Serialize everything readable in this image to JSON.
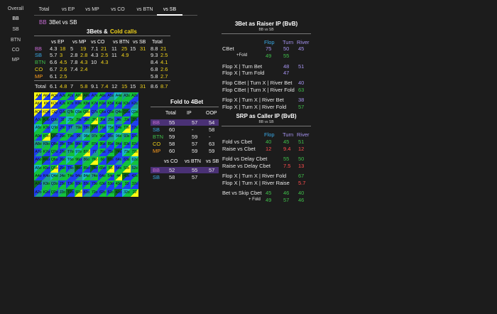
{
  "sidebar": {
    "items": [
      "Overall",
      "BB",
      "SB",
      "BTN",
      "CO",
      "MP"
    ],
    "active": "BB"
  },
  "tabs": {
    "items": [
      "Total",
      "vs EP",
      "vs MP",
      "vs CO",
      "vs BTN",
      "vs SB"
    ],
    "active": "vs SB"
  },
  "matchup": {
    "hero": "BB",
    "title": "3Bet vs SB"
  },
  "threebet_table": {
    "title_a": "3Bets &",
    "title_b": "Cold calls",
    "columns": [
      "vs EP",
      "vs MP",
      "vs CO",
      "vs BTN",
      "vs SB",
      "Total"
    ],
    "rows": [
      {
        "pos": "BB",
        "cells": [
          [
            "4.3",
            "18"
          ],
          [
            "5",
            "19"
          ],
          [
            "7.1",
            "21"
          ],
          [
            "11",
            "25"
          ],
          [
            "15",
            "31"
          ],
          [
            "8.8",
            "21"
          ]
        ]
      },
      {
        "pos": "SB",
        "cells": [
          [
            "5.7",
            "3"
          ],
          [
            "2.8",
            "2.8"
          ],
          [
            "4.3",
            "2.5"
          ],
          [
            "11",
            "4.9"
          ],
          [
            "",
            ""
          ],
          [
            "9.3",
            "2.5"
          ]
        ]
      },
      {
        "pos": "BTN",
        "cells": [
          [
            "6.6",
            "4.5"
          ],
          [
            "7.8",
            "4.3"
          ],
          [
            "10",
            "4.3"
          ],
          [
            "",
            ""
          ],
          [
            "",
            ""
          ],
          [
            "8.4",
            "4.1"
          ]
        ]
      },
      {
        "pos": "CO",
        "cells": [
          [
            "6.7",
            "2.6"
          ],
          [
            "7.4",
            "2.4"
          ],
          [
            "",
            ""
          ],
          [
            "",
            ""
          ],
          [
            "",
            ""
          ],
          [
            "6.8",
            "2.6"
          ]
        ]
      },
      {
        "pos": "MP",
        "cells": [
          [
            "6.1",
            "2.5"
          ],
          [
            "",
            ""
          ],
          [
            "",
            ""
          ],
          [
            "",
            ""
          ],
          [
            "",
            ""
          ],
          [
            "5.8",
            "2.7"
          ]
        ]
      }
    ],
    "total_row": {
      "label": "Total",
      "cells": [
        [
          "6.1",
          "4.8"
        ],
        [
          "7",
          "5.8"
        ],
        [
          "9.1",
          "7.4"
        ],
        [
          "12",
          "15"
        ],
        [
          "15",
          "31"
        ],
        [
          "8.6",
          "8.7"
        ]
      ]
    }
  },
  "hand_matrix": {
    "ranks": [
      "A",
      "K",
      "Q",
      "J",
      "T",
      "9",
      "8",
      "7",
      "6",
      "5",
      "4",
      "3",
      "2"
    ],
    "colors": {
      "green": "#12c23d",
      "blue": "#1f3ff0",
      "yellow": "#ffff12",
      "teal": "#1e9e8e",
      "dark_green": "#0b6b1f",
      "cyan": "#19b9c8"
    }
  },
  "fold4bet": {
    "title": "Fold to 4Bet",
    "columns": [
      "Total",
      "IP",
      "OOP"
    ],
    "rows": [
      {
        "pos": "BB",
        "vals": [
          "55",
          "57",
          "54"
        ]
      },
      {
        "pos": "SB",
        "vals": [
          "60",
          "-",
          "58"
        ]
      },
      {
        "pos": "BTN",
        "vals": [
          "59",
          "59",
          "-"
        ]
      },
      {
        "pos": "CO",
        "vals": [
          "58",
          "57",
          "63"
        ]
      },
      {
        "pos": "MP",
        "vals": [
          "60",
          "59",
          "59"
        ]
      }
    ],
    "columns2": [
      "vs CO",
      "vs BTN",
      "vs SB"
    ],
    "rows2": [
      {
        "pos": "BB",
        "vals": [
          "52",
          "55",
          "57"
        ]
      },
      {
        "pos": "SB",
        "vals": [
          "58",
          "57",
          ""
        ]
      }
    ]
  },
  "raiser": {
    "title": "3Bet as Raiser IP (BvB)",
    "subtitle": "BB vs SB",
    "headers": [
      "Flop",
      "Turn",
      "River"
    ],
    "rows": [
      {
        "label": "CBet",
        "vals": [
          "75",
          "50",
          "45"
        ],
        "sub": false
      },
      {
        "label": "+Fold",
        "vals": [
          "49",
          "55",
          ""
        ],
        "sub": true
      },
      {
        "label": "Flop X | Turn Bet",
        "vals": [
          "",
          "48",
          "51"
        ],
        "sub": false
      },
      {
        "label": "Flop X | Turn Fold",
        "vals": [
          "",
          "47",
          ""
        ],
        "sub": false
      },
      {
        "label": "Flop CBet | Turn X | River Bet",
        "vals": [
          "",
          "",
          "40"
        ],
        "sub": false
      },
      {
        "label": "Flop CBet | Turn X | River Fold",
        "vals": [
          "",
          "",
          "63"
        ],
        "sub": false
      },
      {
        "label": "Flop X | Turn X | River Bet",
        "vals": [
          "",
          "",
          "38"
        ],
        "sub": false
      },
      {
        "label": "Flop X | Turn X | River Fold",
        "vals": [
          "",
          "",
          "57"
        ],
        "sub": false
      }
    ]
  },
  "caller": {
    "title": "SRP as Caller IP (BvB)",
    "subtitle": "BB vs SB",
    "headers": [
      "Flop",
      "Turn",
      "River"
    ],
    "rows": [
      {
        "label": "Fold vs Cbet",
        "vals": [
          "40",
          "45",
          "51"
        ],
        "sub": false
      },
      {
        "label": "Raise vs Cbet",
        "vals": [
          "12",
          "9.4",
          "12"
        ],
        "sub": false
      },
      {
        "label": "Fold vs Delay Cbet",
        "vals": [
          "",
          "55",
          "50"
        ],
        "sub": false
      },
      {
        "label": "Raise vs Delay Cbet",
        "vals": [
          "",
          "7.5",
          "13"
        ],
        "sub": false
      },
      {
        "label": "Flop X | Turn X | River Fold",
        "vals": [
          "",
          "",
          "67"
        ],
        "sub": false
      },
      {
        "label": "Flop X | Turn X | River Raise",
        "vals": [
          "",
          "",
          "5.7"
        ],
        "sub": false
      },
      {
        "label": "Bet vs Skip Cbet",
        "vals": [
          "45",
          "46",
          "40"
        ],
        "sub": false
      },
      {
        "label": "+ Fold",
        "vals": [
          "49",
          "57",
          "46"
        ],
        "sub": true
      }
    ]
  }
}
